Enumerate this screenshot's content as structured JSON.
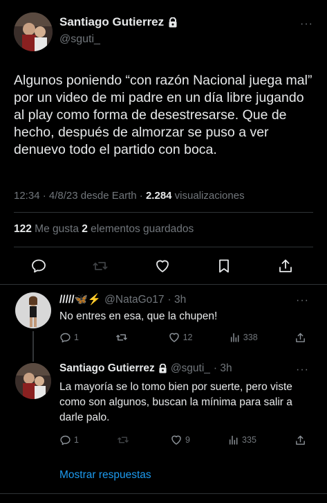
{
  "main_tweet": {
    "name": "Santiago Gutierrez",
    "handle": "@sguti_",
    "more": "···",
    "text": "Algunos poniendo “con razón Nacional juega mal” por un video de mi padre en un día libre jugando al play como forma de desestresarse. Que de hecho, después de almorzar se puso a ver denuevo todo el partido con boca.",
    "time_date": "12:34 · 4/8/23 desde Earth · ",
    "views": "2.284",
    "views_label": " visualizaciones",
    "likes": "122",
    "likes_label": " Me gusta ",
    "bookmarks": "2",
    "bookmarks_label": " elementos guardados",
    "action_icons": [
      "reply-icon",
      "retweet-icon",
      "heart-icon",
      "bookmark-icon",
      "share-icon"
    ]
  },
  "replies": [
    {
      "name": "/////🦋⚡",
      "handle": "@NataGo17",
      "time": " · 3h",
      "more": "···",
      "text": "No entres en esa, que la chupen!",
      "replies": "1",
      "retweets": "",
      "likes": "12",
      "views": "338"
    },
    {
      "name": "Santiago Gutierrez",
      "handle": "@sguti_",
      "time": " · 3h",
      "more": "···",
      "text": "La mayoría se lo tomo bien por suerte, pero viste como son algunos, buscan la mínima para salir a darle palo.",
      "replies": "1",
      "retweets": "",
      "likes": "9",
      "views": "335"
    }
  ],
  "show_replies": "Mostrar respuestas",
  "colors": {
    "background": "#000000",
    "text": "#e7e9ea",
    "secondary": "#71767b",
    "accent": "#1d9bf0",
    "separator": "#2f3336"
  }
}
